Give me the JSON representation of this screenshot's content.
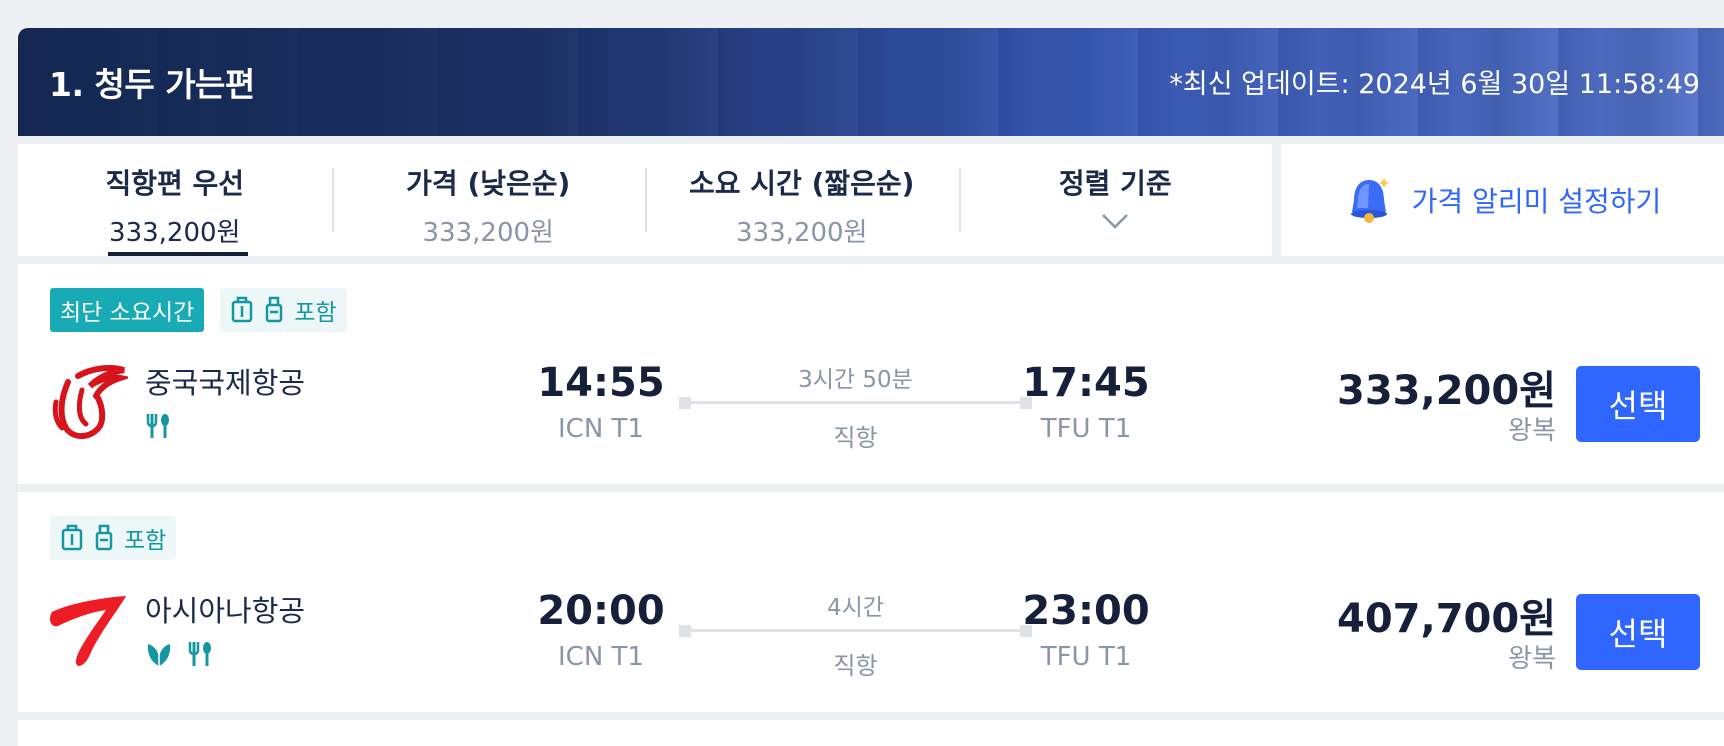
{
  "header": {
    "title": "1. 청두 가는편",
    "update_text": "*최신 업데이트: 2024년 6월 30일 11:58:49"
  },
  "sort_tabs": [
    {
      "label": "직항편 우선",
      "price": "333,200원",
      "active": true
    },
    {
      "label": "가격 (낮은순)",
      "price": "333,200원",
      "active": false
    },
    {
      "label": "소요 시간 (짧은순)",
      "price": "333,200원",
      "active": false
    },
    {
      "label": "정렬 기준",
      "icon": "chevron-down-icon"
    }
  ],
  "price_alert": {
    "label": "가격 알리미 설정하기",
    "icon": "bell-icon"
  },
  "flights": [
    {
      "badges": [
        {
          "text": "최단 소요시간",
          "style": "solid"
        },
        {
          "text": "포함",
          "style": "soft",
          "icons": [
            "carry-on-bag-icon",
            "checked-bag-icon"
          ]
        }
      ],
      "airline": "중국국제항공",
      "logo": "air-china-logo",
      "amenities": [
        "meal-icon"
      ],
      "depart_time": "14:55",
      "depart_airport": "ICN T1",
      "duration": "3시간 50분",
      "stops": "직항",
      "arrive_time": "17:45",
      "arrive_airport": "TFU T1",
      "price": "333,200원",
      "trip_type": "왕복",
      "select_label": "선택"
    },
    {
      "badges": [
        {
          "text": "포함",
          "style": "soft",
          "icons": [
            "carry-on-bag-icon",
            "checked-bag-icon"
          ]
        }
      ],
      "airline": "아시아나항공",
      "logo": "asiana-logo",
      "amenities": [
        "eco-leaf-icon",
        "meal-icon"
      ],
      "depart_time": "20:00",
      "depart_airport": "ICN T1",
      "duration": "4시간",
      "stops": "직항",
      "arrive_time": "23:00",
      "arrive_airport": "TFU T1",
      "price": "407,700원",
      "trip_type": "왕복",
      "select_label": "선택"
    }
  ],
  "colors": {
    "accent_blue": "#2e66ff",
    "teal_badge": "#18aab5",
    "navy_text": "#16203a",
    "air_china_red": "#d7141c",
    "asiana_red": "#ee1c25"
  }
}
